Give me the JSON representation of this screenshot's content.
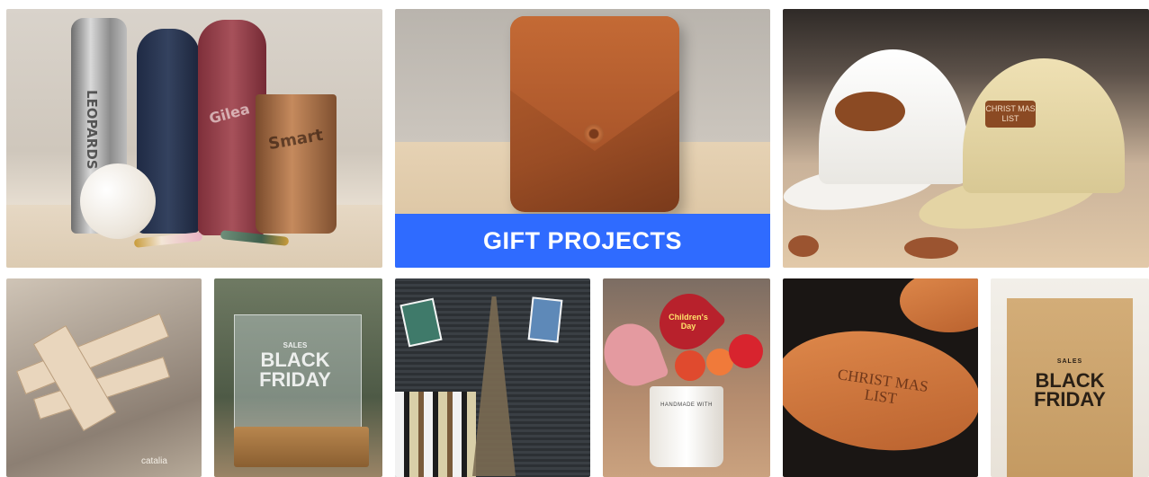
{
  "banner": {
    "label": "GIFT PROJECTS",
    "color": "#2f6bff"
  },
  "tiles": [
    {
      "subject": "engraved drinkware",
      "engravings": [
        "LEOPARDS",
        "Gilea",
        "Smart"
      ]
    },
    {
      "subject": "engraved leather bag"
    },
    {
      "subject": "caps with leather patches",
      "patches": [
        "CHRIST MAS LIST"
      ]
    },
    {
      "subject": "wooden plane model",
      "caption": "catalia"
    },
    {
      "subject": "acrylic sign",
      "sign": {
        "top": "SALES",
        "main": "BLACK FRIDAY"
      }
    },
    {
      "subject": "eiffel tower model"
    },
    {
      "subject": "flower pot",
      "card": "Children's Day",
      "pot_label": "HANDMADE WITH"
    },
    {
      "subject": "leather coaster",
      "text": "CHRIST MAS LIST"
    },
    {
      "subject": "kraft bag",
      "bag": {
        "top": "SALES",
        "main": "BLACK FRIDAY"
      }
    }
  ]
}
